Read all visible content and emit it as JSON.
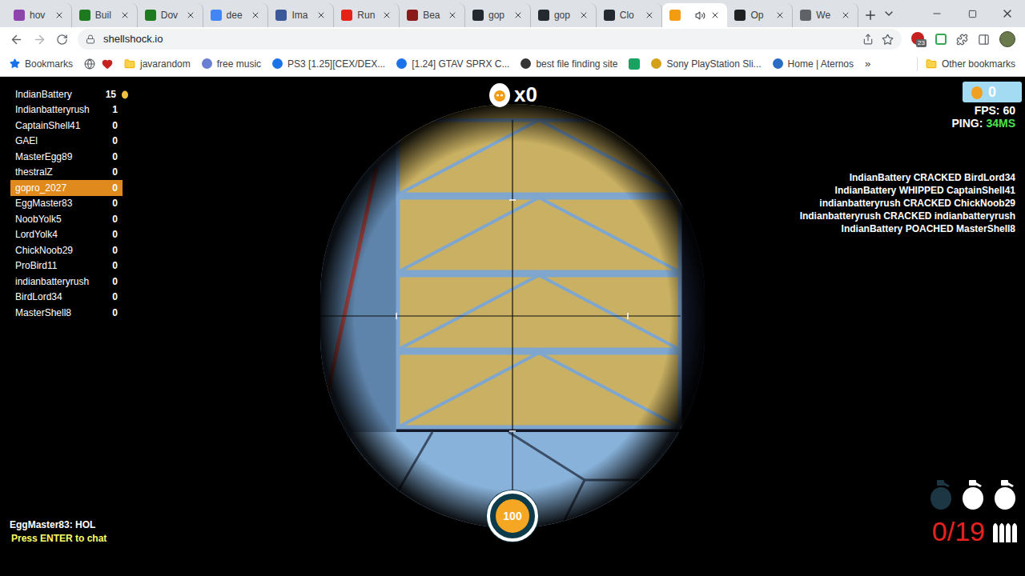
{
  "browser": {
    "tabs": [
      {
        "label": "hov",
        "color": "#8e44ad",
        "selected": false,
        "audio": false
      },
      {
        "label": "Buil",
        "color": "#1e7a1e",
        "selected": false,
        "audio": false
      },
      {
        "label": "Dov",
        "color": "#1e7a1e",
        "selected": false,
        "audio": false
      },
      {
        "label": "dee",
        "color": "#4285f4",
        "selected": false,
        "audio": false
      },
      {
        "label": "Ima",
        "color": "#3b5998",
        "selected": false,
        "audio": false
      },
      {
        "label": "Run",
        "color": "#e62117",
        "selected": false,
        "audio": false
      },
      {
        "label": "Bea",
        "color": "#8b1a1a",
        "selected": false,
        "audio": false
      },
      {
        "label": "gop",
        "color": "#24292f",
        "selected": false,
        "audio": false
      },
      {
        "label": "gop",
        "color": "#24292f",
        "selected": false,
        "audio": false
      },
      {
        "label": "Clo",
        "color": "#24292f",
        "selected": false,
        "audio": false
      },
      {
        "label": "",
        "color": "#f39c12",
        "selected": true,
        "audio": true
      },
      {
        "label": "Op",
        "color": "#202123",
        "selected": false,
        "audio": false
      },
      {
        "label": "We",
        "color": "#5f6368",
        "selected": false,
        "audio": false
      }
    ],
    "address": "shellshock.io",
    "extension_badge": "23",
    "bookmarks": [
      {
        "kind": "text",
        "label": "Bookmarks"
      },
      {
        "kind": "globe"
      },
      {
        "kind": "heart"
      },
      {
        "kind": "folder",
        "label": "javarandom"
      },
      {
        "kind": "link",
        "label": "free music",
        "color": "#6a7fd1"
      },
      {
        "kind": "link",
        "label": "PS3 [1.25][CEX/DEX...",
        "color": "#1a73e8"
      },
      {
        "kind": "link",
        "label": "[1.24] GTAV SPRX C...",
        "color": "#1a73e8"
      },
      {
        "kind": "link",
        "label": "best file finding site",
        "color": "#333333"
      },
      {
        "kind": "icon",
        "color": "#1aa260"
      },
      {
        "kind": "link",
        "label": "Sony PlayStation Sli...",
        "color": "#d4a017"
      },
      {
        "kind": "link",
        "label": "Home | Aternos",
        "color": "#2a6cc4"
      }
    ],
    "overflow": "»",
    "other_bookmarks": "Other bookmarks"
  },
  "game": {
    "scoreboard": [
      {
        "name": "IndianBattery",
        "score": "15",
        "selected": false,
        "leader": true
      },
      {
        "name": "Indianbatteryrush",
        "score": "1",
        "selected": false,
        "leader": false
      },
      {
        "name": "CaptainShell41",
        "score": "0",
        "selected": false,
        "leader": false
      },
      {
        "name": "GAEl",
        "score": "0",
        "selected": false,
        "leader": false
      },
      {
        "name": "MasterEgg89",
        "score": "0",
        "selected": false,
        "leader": false
      },
      {
        "name": "thestralZ",
        "score": "0",
        "selected": false,
        "leader": false
      },
      {
        "name": "gopro_2027",
        "score": "0",
        "selected": true,
        "leader": false
      },
      {
        "name": "EggMaster83",
        "score": "0",
        "selected": false,
        "leader": false
      },
      {
        "name": "NoobYolk5",
        "score": "0",
        "selected": false,
        "leader": false
      },
      {
        "name": "LordYolk4",
        "score": "0",
        "selected": false,
        "leader": false
      },
      {
        "name": "ChickNoob29",
        "score": "0",
        "selected": false,
        "leader": false
      },
      {
        "name": "ProBird11",
        "score": "0",
        "selected": false,
        "leader": false
      },
      {
        "name": "indianbatteryrush",
        "score": "0",
        "selected": false,
        "leader": false
      },
      {
        "name": "BirdLord34",
        "score": "0",
        "selected": false,
        "leader": false
      },
      {
        "name": "MasterShell8",
        "score": "0",
        "selected": false,
        "leader": false
      }
    ],
    "kill_streak": "x0",
    "eggs": "0",
    "fps": "FPS: 60",
    "ping_label": "PING:",
    "ping": "34MS",
    "kill_feed": [
      "IndianBattery CRACKED BirdLord34",
      "IndianBattery WHIPPED CaptainShell41",
      "indianbatteryrush CRACKED ChickNoob29",
      "Indianbatteryrush CRACKED indianbatteryrush",
      "IndianBattery POACHED MasterShell8"
    ],
    "chat": [
      "EggMaster83: HOL"
    ],
    "chat_hint": "Press ENTER to chat",
    "health": {
      "value": "100",
      "level": 1
    },
    "ammo": "0/19",
    "grenades": [
      {
        "available": false
      },
      {
        "available": true
      },
      {
        "available": true
      }
    ]
  }
}
